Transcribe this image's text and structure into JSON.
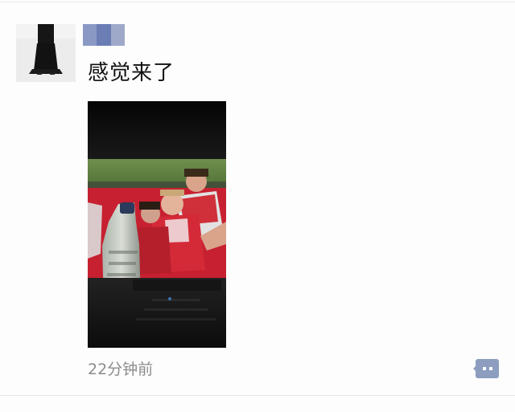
{
  "post": {
    "text": "感觉来了",
    "timestamp": "22分钟前"
  },
  "icons": {
    "avatar": "avatar-silhouette",
    "comment": "comment-bubble-icon"
  },
  "colors": {
    "username_blocks": [
      "#8a99c4",
      "#6a7db5",
      "#9ea9c9"
    ],
    "timestamp": "#8c8c8c",
    "comment_button": "#8c9dc0"
  }
}
